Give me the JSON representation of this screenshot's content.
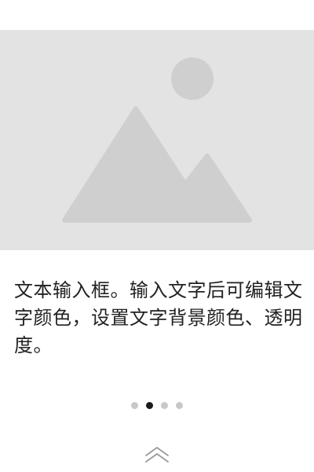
{
  "hero_image": {
    "icon": "image-placeholder-icon",
    "background_color": "#e3e3e3",
    "shape_color": "#cfcfcf"
  },
  "description": {
    "text": "文本输入框。输入文字后可编辑文字颜色，设置文字背景颜色、透明度。"
  },
  "pager": {
    "total_pages": 4,
    "current_page": 2,
    "active_color": "#1a1a1a",
    "inactive_color": "#c8c8c8"
  },
  "footer": {
    "icon": "double-chevron-up-icon"
  }
}
